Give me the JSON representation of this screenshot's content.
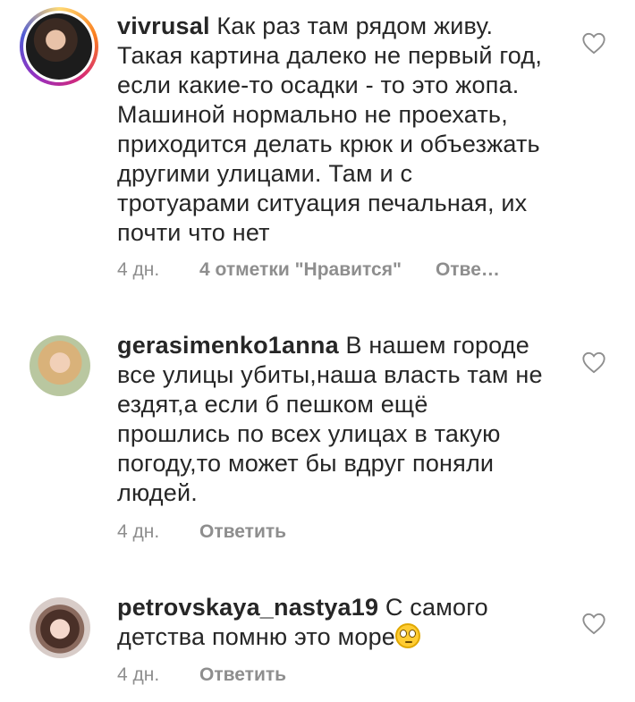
{
  "comments": [
    {
      "username": "vivrusal",
      "text": "Как раз там рядом живу. Такая картина далеко не первый год, если какие-то осадки - то это жопа. Машиной нормально не проехать, приходится делать крюк и объезжать другими улицами. Там и с тротуарами ситуация печальная, их почти что нет",
      "time": "4 дн.",
      "likes": "4 отметки \"Нравится\"",
      "reply": "Отве…"
    },
    {
      "username": "gerasimenko1anna",
      "text": "В нашем городе все улицы убиты,наша власть там не ездят,а если б пешком ещё прошлись по всех улицах в такую погоду,то может бы вдруг поняли людей.",
      "time": "4 дн.",
      "reply": "Ответить"
    },
    {
      "username": "petrovskaya_nastya19",
      "text": "С самого детства помню это море",
      "emoji": "face-with-rolling-eyes",
      "time": "4 дн.",
      "reply": "Ответить"
    }
  ],
  "colors": {
    "text": "#262626",
    "secondary": "#8e8e8e",
    "background": "#ffffff"
  }
}
